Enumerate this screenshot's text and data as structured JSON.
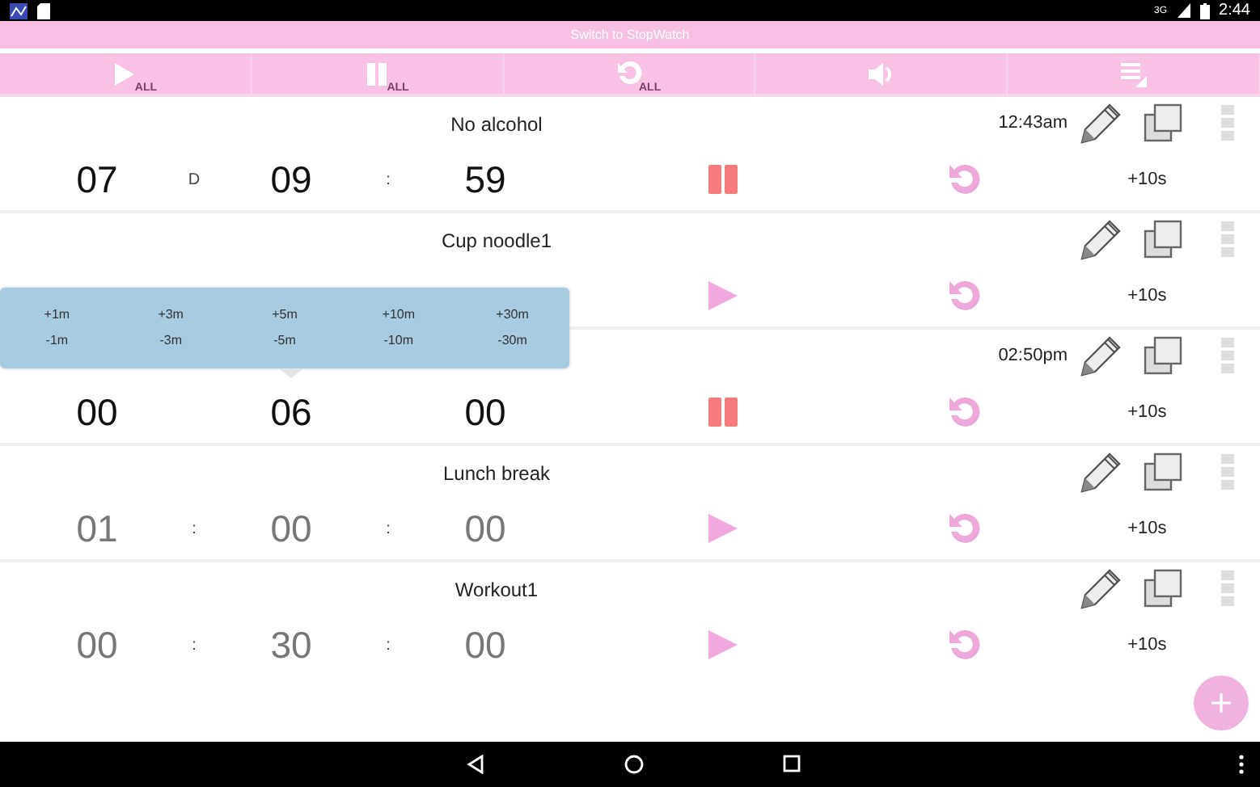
{
  "status_bar": {
    "network": "3G",
    "time": "2:44"
  },
  "switch_bar": {
    "label": "Switch to StopWatch"
  },
  "toolbar": [
    {
      "kind": "play",
      "label": "ALL"
    },
    {
      "kind": "pause",
      "label": "ALL"
    },
    {
      "kind": "reset",
      "label": "ALL"
    },
    {
      "kind": "volume"
    },
    {
      "kind": "list"
    }
  ],
  "timers": [
    {
      "name": "No alcohol",
      "time": "12:43am",
      "digits": [
        "07",
        "09",
        "59"
      ],
      "separators": [
        "D",
        ":"
      ],
      "running": true,
      "increment": "+10s"
    },
    {
      "name": "Cup noodle1",
      "running": false,
      "increment": "+10s"
    },
    {
      "time": "02:50pm",
      "digits": [
        "00",
        "06",
        "00"
      ],
      "running": true,
      "increment": "+10s"
    },
    {
      "name": "Lunch break",
      "digits": [
        "01",
        "00",
        "00"
      ],
      "separators": [
        ":",
        ":"
      ],
      "running": false,
      "increment": "+10s"
    },
    {
      "name": "Workout1",
      "digits": [
        "00",
        "30",
        "00"
      ],
      "separators": [
        ":",
        ":"
      ],
      "running": false,
      "increment": "+10s"
    }
  ],
  "adjust_popup": {
    "add": [
      "+1m",
      "+3m",
      "+5m",
      "+10m",
      "+30m"
    ],
    "subtract": [
      "-1m",
      "-3m",
      "-5m",
      "-10m",
      "-30m"
    ]
  }
}
